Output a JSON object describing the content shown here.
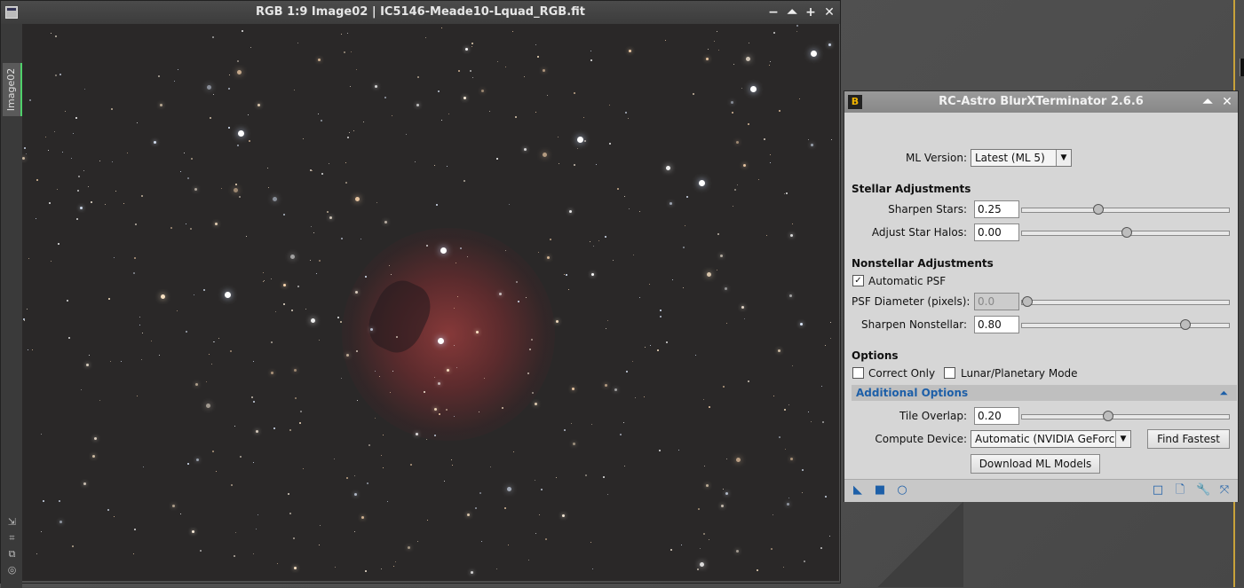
{
  "image_window": {
    "title": "RGB 1:9 Image02 | IC5146-Meade10-Lquad_RGB.fit",
    "side_tab": "Image02",
    "buttons": {
      "minimize": "−",
      "shade": "⏶",
      "maximize": "+",
      "close": "✕"
    }
  },
  "dialog": {
    "title": "RC-Astro BlurXTerminator 2.6.6",
    "icon_letter": "B",
    "ml_version_label": "ML Version:",
    "ml_version_value": "Latest (ML 5)",
    "stellar_heading": "Stellar Adjustments",
    "sharpen_stars_label": "Sharpen Stars:",
    "sharpen_stars_value": "0.25",
    "sharpen_stars_level": 0.36,
    "adjust_halos_label": "Adjust Star Halos:",
    "adjust_halos_value": "0.00",
    "adjust_halos_level": 0.5,
    "nonstellar_heading": "Nonstellar Adjustments",
    "auto_psf_label": "Automatic PSF",
    "auto_psf_checked": true,
    "psf_diameter_label": "PSF Diameter (pixels):",
    "psf_diameter_value": "0.0",
    "psf_diameter_level": 0.0,
    "sharpen_nonstellar_label": "Sharpen Nonstellar:",
    "sharpen_nonstellar_value": "0.80",
    "sharpen_nonstellar_level": 0.8,
    "options_heading": "Options",
    "correct_only_label": "Correct Only",
    "correct_only_checked": false,
    "lunar_label": "Lunar/Planetary Mode",
    "lunar_checked": false,
    "additional_options_label": "Additional Options",
    "tile_overlap_label": "Tile Overlap:",
    "tile_overlap_value": "0.20",
    "tile_overlap_level": 0.41,
    "compute_device_label": "Compute Device:",
    "compute_device_value": "Automatic (NVIDIA GeForc",
    "find_fastest_label": "Find Fastest",
    "download_models_label": "Download ML Models"
  },
  "colors": {
    "accent_blue": "#1d5fa8",
    "tab_green": "#4fd06a",
    "nebula_red": "#8c3a3c"
  }
}
